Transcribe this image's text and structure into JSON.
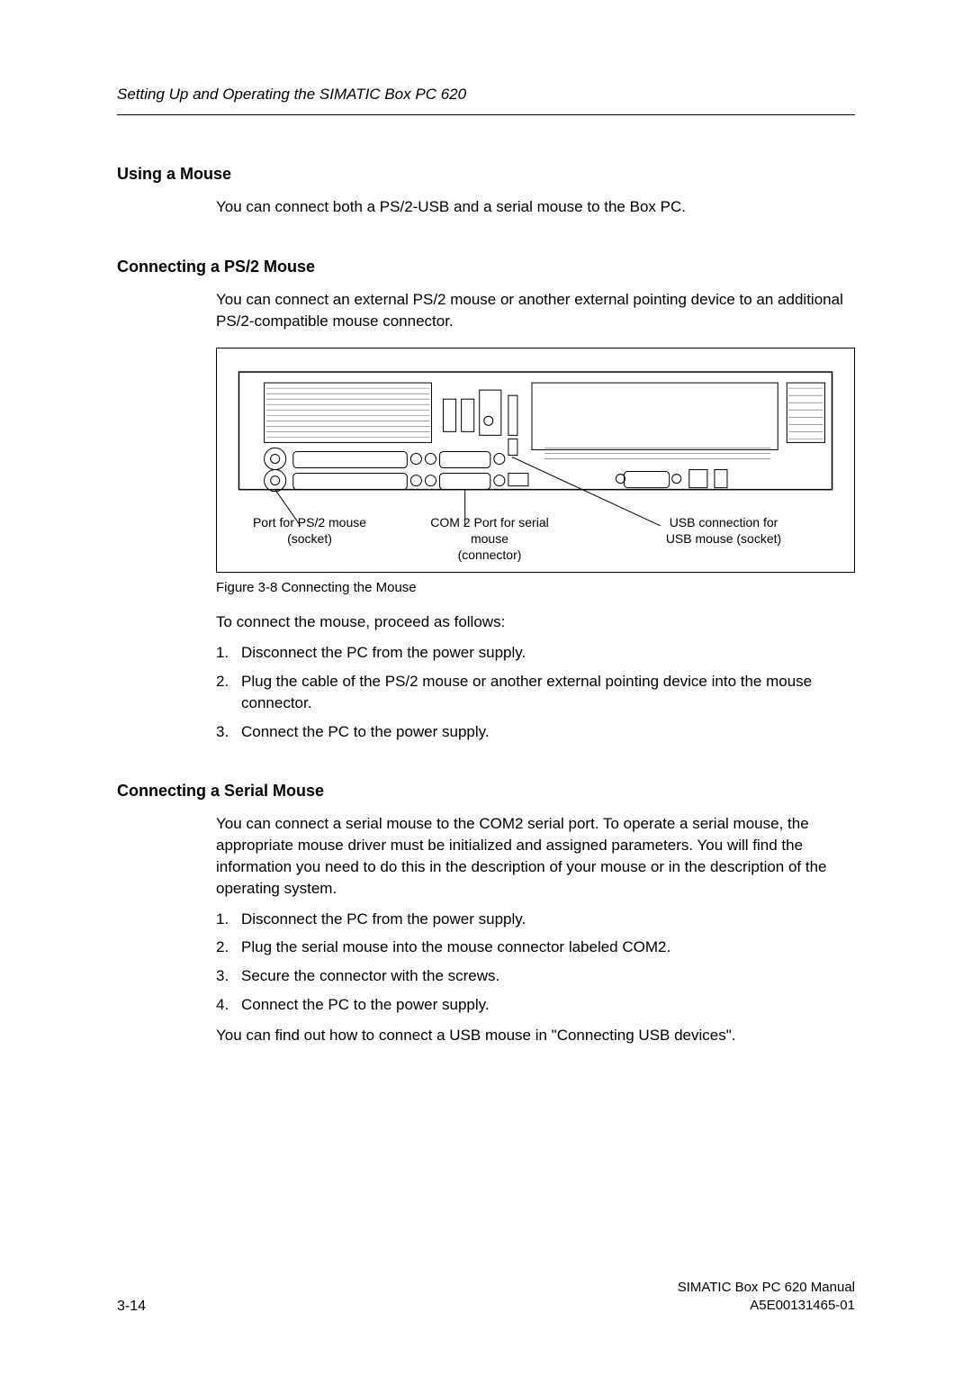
{
  "running_header": "Setting Up and Operating the SIMATIC Box PC 620",
  "sec1": {
    "heading": "Using a Mouse",
    "p1": "You can connect both a PS/2-USB and a serial mouse to the Box PC."
  },
  "sec2": {
    "heading": "Connecting a PS/2 Mouse",
    "p1": "You can connect an external PS/2 mouse or another external pointing device to an additional PS/2-compatible mouse connector.",
    "figure": {
      "caption": "Figure 3-8    Connecting the Mouse",
      "label1a": "Port for  PS/2 mouse",
      "label1b": "(socket)",
      "label2a": "COM 2 Port for  serial mouse",
      "label2b": "(connector)",
      "label3a": "USB connection for",
      "label3b": "USB mouse (socket)"
    },
    "p2": "To connect the mouse, proceed as follows:",
    "steps": {
      "s1": "Disconnect the PC from the power supply.",
      "s2": "Plug the cable of the PS/2 mouse or another external pointing device into the mouse connector.",
      "s3": "Connect the PC to the power supply."
    }
  },
  "sec3": {
    "heading": "Connecting a Serial Mouse",
    "p1": "You can connect a serial mouse to the COM2 serial port. To operate a serial mouse, the appropriate mouse driver must be initialized and assigned parameters. You will find the information you need to do this in the description of your mouse or in the description of the operating system.",
    "steps": {
      "s1": "Disconnect the PC from the power supply.",
      "s2": "Plug the serial mouse into the mouse connector labeled COM2.",
      "s3": "Secure the connector with the screws.",
      "s4": "Connect the PC to the power supply."
    },
    "p2": "You can find out how to connect a USB mouse in \"Connecting USB devices\"."
  },
  "footer": {
    "page": "3-14",
    "title": "SIMATIC Box PC 620  Manual",
    "docid": "A5E00131465-01"
  }
}
